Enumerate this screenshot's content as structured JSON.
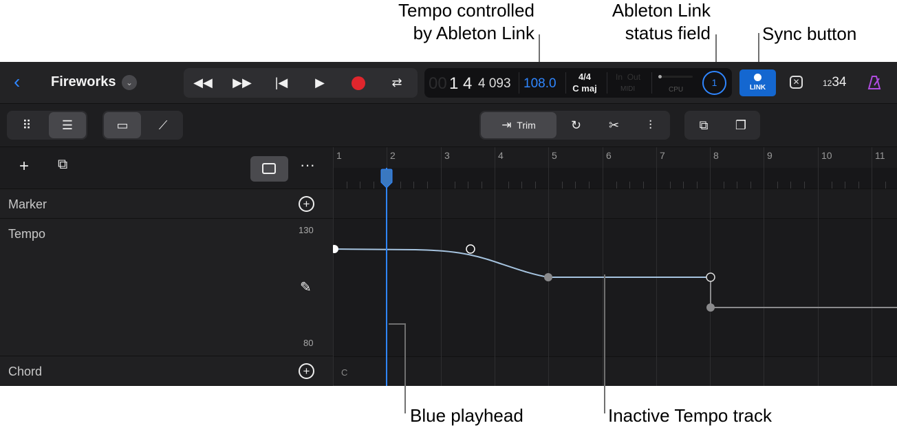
{
  "callouts": {
    "tempo_link": [
      "Tempo controlled",
      "by Ableton Link"
    ],
    "link_status": [
      "Ableton Link",
      "status field"
    ],
    "sync_button": "Sync button",
    "playhead": "Blue playhead",
    "inactive_tempo": "Inactive Tempo track"
  },
  "topbar": {
    "back_icon": "chevron-left-icon",
    "project_name": "Fireworks",
    "transport": [
      "rewind-icon",
      "fast-forward-icon",
      "go-to-start-icon",
      "play-icon",
      "record-icon",
      "cycle-icon"
    ],
    "lcd": {
      "faded_digits": "00",
      "position": "1 4",
      "ticks": "4 093",
      "tempo": "108.0",
      "signature": "4/4",
      "key": "C maj",
      "in_label": "In",
      "out_label": "Out",
      "midi_label": "MIDI",
      "cpu_label": "CPU",
      "link_peers": "1"
    },
    "sync_label": "LINK",
    "count_in_small": "12",
    "count_in_large": "34",
    "colors": {
      "accent": "#2f86ff",
      "record": "#e0262d",
      "metronome": "#b04ce0"
    }
  },
  "toolbar2": {
    "trim_label": "Trim"
  },
  "headers": {
    "tracks": [
      {
        "name": "Marker"
      },
      {
        "name": "Tempo",
        "max": "130",
        "min": "80"
      },
      {
        "name": "Chord"
      }
    ]
  },
  "timeline": {
    "bars": [
      "1",
      "2",
      "3",
      "4",
      "5",
      "6",
      "7",
      "8",
      "9",
      "10",
      "11"
    ],
    "chord_label": "C"
  }
}
